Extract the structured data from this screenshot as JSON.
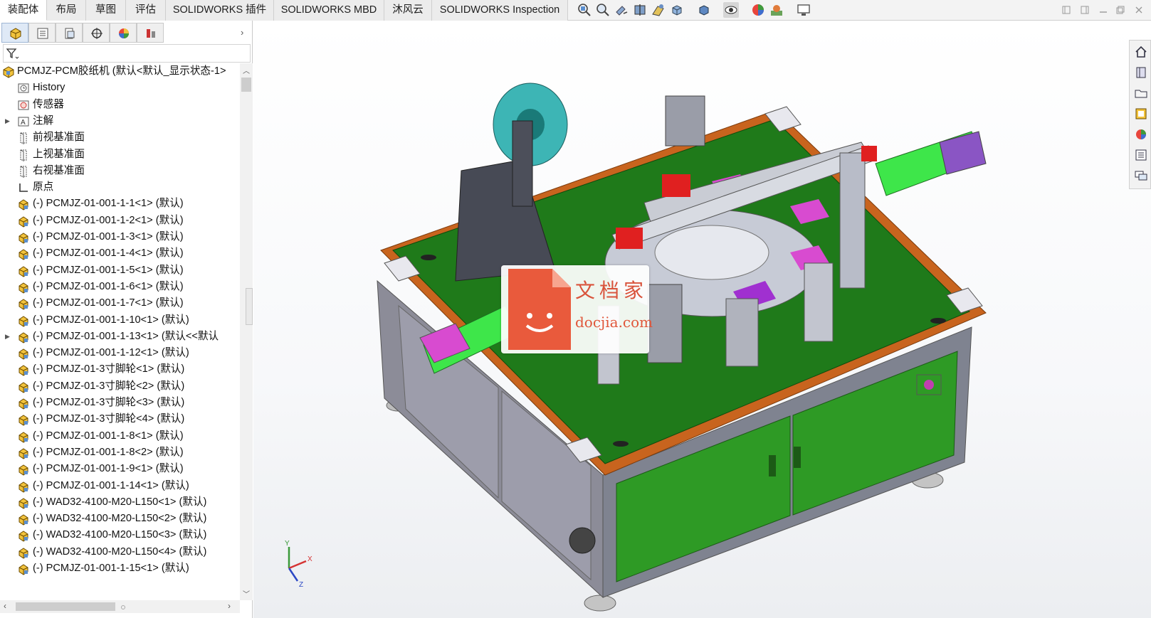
{
  "tabs": [
    {
      "label": "装配体",
      "active": true
    },
    {
      "label": "布局"
    },
    {
      "label": "草图"
    },
    {
      "label": "评估"
    },
    {
      "label": "SOLIDWORKS 插件"
    },
    {
      "label": "SOLIDWORKS MBD"
    },
    {
      "label": "沐风云"
    },
    {
      "label": "SOLIDWORKS Inspection"
    }
  ],
  "toolbar_icons": [
    "zoom-to-fit-icon",
    "zoom-area-icon",
    "previous-view-icon",
    "section-view-icon",
    "dynamic-annotation-icon",
    "view-orientation-icon",
    "display-style-icon",
    "hide-show-icon",
    "edit-appearance-icon",
    "apply-scene-icon",
    "view-settings-icon"
  ],
  "window_controls": [
    "restore-icon",
    "tile-icon",
    "minimize-icon",
    "maximize-icon",
    "close-icon"
  ],
  "panel_tabs": [
    "feature-manager-icon",
    "property-manager-icon",
    "configuration-manager-icon",
    "dimxpert-icon",
    "display-manager-icon",
    "cam-icon"
  ],
  "tree": {
    "root": "PCMJZ-PCM胶纸机  (默认<默认_显示状态-1>",
    "items": [
      {
        "label": "History",
        "icon": "history-icon"
      },
      {
        "label": "传感器",
        "icon": "sensor-icon"
      },
      {
        "label": "注解",
        "icon": "annotation-icon",
        "expandable": true
      },
      {
        "label": "前视基准面",
        "icon": "plane-icon"
      },
      {
        "label": "上视基准面",
        "icon": "plane-icon"
      },
      {
        "label": "右视基准面",
        "icon": "plane-icon"
      },
      {
        "label": "原点",
        "icon": "origin-icon"
      },
      {
        "label": "(-) PCMJZ-01-001-1-1<1> (默认)",
        "icon": "subassembly-icon"
      },
      {
        "label": "(-) PCMJZ-01-001-1-2<1> (默认)",
        "icon": "subassembly-icon"
      },
      {
        "label": "(-) PCMJZ-01-001-1-3<1> (默认)",
        "icon": "subassembly-icon"
      },
      {
        "label": "(-) PCMJZ-01-001-1-4<1> (默认)",
        "icon": "subassembly-icon"
      },
      {
        "label": "(-) PCMJZ-01-001-1-5<1> (默认)",
        "icon": "subassembly-icon"
      },
      {
        "label": "(-) PCMJZ-01-001-1-6<1> (默认)",
        "icon": "subassembly-icon"
      },
      {
        "label": "(-) PCMJZ-01-001-1-7<1> (默认)",
        "icon": "subassembly-icon"
      },
      {
        "label": "(-) PCMJZ-01-001-1-10<1> (默认)",
        "icon": "subassembly-icon"
      },
      {
        "label": "(-) PCMJZ-01-001-1-13<1> (默认<<默认",
        "icon": "subassembly-icon",
        "expandable": true
      },
      {
        "label": "(-) PCMJZ-01-001-1-12<1> (默认)",
        "icon": "subassembly-icon"
      },
      {
        "label": "(-) PCMJZ-01-3寸脚轮<1> (默认)",
        "icon": "subassembly-icon"
      },
      {
        "label": "(-) PCMJZ-01-3寸脚轮<2> (默认)",
        "icon": "subassembly-icon"
      },
      {
        "label": "(-) PCMJZ-01-3寸脚轮<3> (默认)",
        "icon": "subassembly-icon"
      },
      {
        "label": "(-) PCMJZ-01-3寸脚轮<4> (默认)",
        "icon": "subassembly-icon"
      },
      {
        "label": "(-) PCMJZ-01-001-1-8<1> (默认)",
        "icon": "subassembly-icon"
      },
      {
        "label": "(-) PCMJZ-01-001-1-8<2> (默认)",
        "icon": "subassembly-icon"
      },
      {
        "label": "(-) PCMJZ-01-001-1-9<1> (默认)",
        "icon": "subassembly-icon"
      },
      {
        "label": "(-) PCMJZ-01-001-1-14<1> (默认)",
        "icon": "subassembly-icon"
      },
      {
        "label": "(-) WAD32-4100-M20-L150<1> (默认)",
        "icon": "subassembly-icon"
      },
      {
        "label": "(-) WAD32-4100-M20-L150<2> (默认)",
        "icon": "subassembly-icon"
      },
      {
        "label": "(-) WAD32-4100-M20-L150<3> (默认)",
        "icon": "subassembly-icon"
      },
      {
        "label": "(-) WAD32-4100-M20-L150<4> (默认)",
        "icon": "subassembly-icon"
      },
      {
        "label": "(-) PCMJZ-01-001-1-15<1> (默认)",
        "icon": "subassembly-icon"
      }
    ]
  },
  "task_pane_icons": [
    "home-icon",
    "design-library-icon",
    "file-explorer-icon",
    "view-palette-icon",
    "appearances-icon",
    "custom-properties-icon",
    "forum-icon"
  ],
  "watermark": {
    "title": "文档家",
    "site": "docjia.com"
  },
  "triad": {
    "x": "X",
    "y": "Y",
    "z": "Z"
  },
  "colors": {
    "machine_green": "#1f7a1a",
    "frame_orange": "#c8641e",
    "frame_grey": "#9a9aa6",
    "watermark_red": "#e95a3c"
  }
}
